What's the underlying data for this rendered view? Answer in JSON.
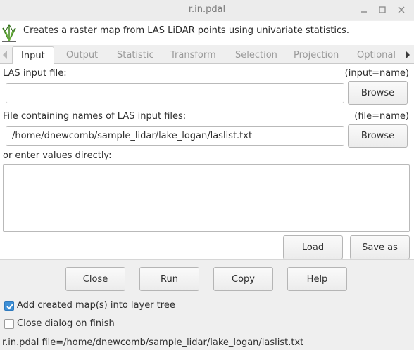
{
  "window": {
    "title": "r.in.pdal"
  },
  "header": {
    "description": "Creates a raster map from LAS LiDAR points using univariate statistics."
  },
  "tabs": [
    {
      "label": "Input",
      "active": true
    },
    {
      "label": "Output"
    },
    {
      "label": "Statistic"
    },
    {
      "label": "Transform"
    },
    {
      "label": "Selection"
    },
    {
      "label": "Projection"
    },
    {
      "label": "Optional"
    }
  ],
  "input_panel": {
    "las_input": {
      "label": "LAS input file:",
      "param": "(input=name)",
      "value": "",
      "browse_label": "Browse"
    },
    "file_list": {
      "label": "File containing names of LAS input files:",
      "param": "(file=name)",
      "value": "/home/dnewcomb/sample_lidar/lake_logan/laslist.txt",
      "browse_label": "Browse"
    },
    "direct_entry": {
      "label": "or enter values directly:",
      "value": ""
    },
    "load_label": "Load",
    "save_as_label": "Save as"
  },
  "actions": {
    "close_label": "Close",
    "run_label": "Run",
    "copy_label": "Copy",
    "help_label": "Help"
  },
  "options": {
    "add_to_layer_tree": {
      "label": "Add created map(s) into layer tree",
      "checked": true
    },
    "close_on_finish": {
      "label": "Close dialog on finish",
      "checked": false
    }
  },
  "statusbar": {
    "command": "r.in.pdal file=/home/dnewcomb/sample_lidar/lake_logan/laslist.txt"
  },
  "colors": {
    "accent": "#3d8fd6",
    "window_bg": "#efefef",
    "panel_bg": "#ffffff"
  },
  "icons": {
    "app": "grass-logo-icon",
    "tabs_prev": "chevron-left-icon",
    "tabs_next": "chevron-right-icon",
    "minimize": "minimize-icon",
    "maximize": "maximize-icon",
    "close": "close-icon",
    "checkmark": "checkmark-icon"
  }
}
